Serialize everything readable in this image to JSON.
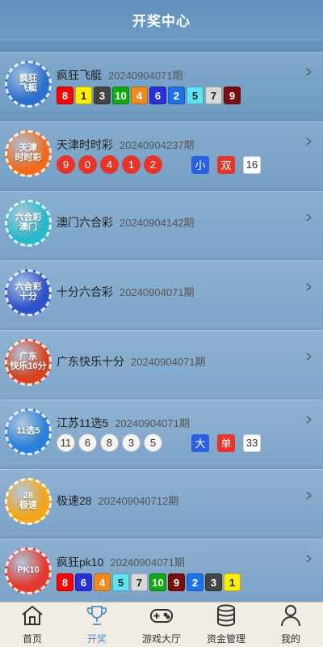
{
  "header": {
    "title": "开奖中心"
  },
  "lotteries": [
    {
      "name": "疯狂飞艇",
      "issue": "20240904071期",
      "logo_text": [
        "疯狂",
        "飞艇"
      ],
      "logo_color": "#2d6fcf",
      "balls": [
        {
          "v": "8",
          "c": "#ff0000"
        },
        {
          "v": "1",
          "c": "#ffee00",
          "light": true
        },
        {
          "v": "3",
          "c": "#444444"
        },
        {
          "v": "10",
          "c": "#11aa11"
        },
        {
          "v": "4",
          "c": "#f08a1c"
        },
        {
          "v": "6",
          "c": "#2a2fd8"
        },
        {
          "v": "2",
          "c": "#1e73e8"
        },
        {
          "v": "5",
          "c": "#5ee5f5",
          "light": true
        },
        {
          "v": "7",
          "c": "#d8d8d8",
          "light": true
        },
        {
          "v": "9",
          "c": "#7a0d0d"
        }
      ]
    },
    {
      "name": "天津时时彩",
      "issue": "20240904237期",
      "logo_text": [
        "天津",
        "时时彩"
      ],
      "logo_color": "#f06a1e",
      "circles": [
        "9",
        "0",
        "4",
        "1",
        "2"
      ],
      "tags": [
        "小",
        "双",
        "16"
      ]
    },
    {
      "name": "澳门六合彩",
      "issue": "20240904142期",
      "logo_text": [
        "六合彩",
        "澳门"
      ],
      "logo_color": "#2ab7c9"
    },
    {
      "name": "十分六合彩",
      "issue": "20240904071期",
      "logo_text": [
        "六合彩",
        "十分"
      ],
      "logo_color": "#2c52c8"
    },
    {
      "name": "广东快乐十分",
      "issue": "20240904071期",
      "logo_text": [
        "广东",
        "快乐10分"
      ],
      "logo_color": "#d8401e"
    },
    {
      "name": "江苏11选5",
      "issue": "20240904071期",
      "logo_text": [
        "11选5"
      ],
      "logo_color": "#2a7fd8",
      "white_circles": [
        "11",
        "6",
        "8",
        "3",
        "5"
      ],
      "tags": [
        "大",
        "单",
        "33"
      ]
    },
    {
      "name": "极速28",
      "issue": "20240904071 2期",
      "issue_display": "20240904071 2期",
      "logo_text": [
        "28",
        "极速"
      ],
      "logo_color": "#f3a41a"
    },
    {
      "name": "疯狂pk10",
      "issue": "20240904071期",
      "logo_text": [
        "PK10"
      ],
      "logo_color": "#e23a2e",
      "balls": [
        {
          "v": "8",
          "c": "#ff0000"
        },
        {
          "v": "6",
          "c": "#2a2fd8"
        },
        {
          "v": "4",
          "c": "#f08a1c"
        },
        {
          "v": "5",
          "c": "#5ee5f5",
          "light": true
        },
        {
          "v": "7",
          "c": "#d8d8d8",
          "light": true
        },
        {
          "v": "10",
          "c": "#11aa11"
        },
        {
          "v": "9",
          "c": "#7a0d0d"
        },
        {
          "v": "2",
          "c": "#1e73e8"
        },
        {
          "v": "3",
          "c": "#444444"
        },
        {
          "v": "1",
          "c": "#ffee00",
          "light": true
        }
      ]
    }
  ],
  "tabs": [
    {
      "label": "首页",
      "icon": "home-icon",
      "active": false
    },
    {
      "label": "开奖",
      "icon": "trophy-icon",
      "active": true
    },
    {
      "label": "游戏大厅",
      "icon": "gamepad-icon",
      "active": false
    },
    {
      "label": "资金管理",
      "icon": "coins-icon",
      "active": false
    },
    {
      "label": "我的",
      "icon": "user-icon",
      "active": false
    }
  ]
}
